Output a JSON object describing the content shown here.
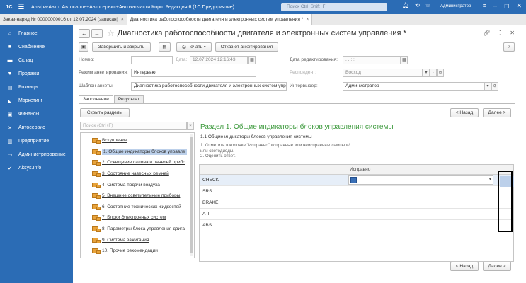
{
  "titlebar": {
    "logo": "1С",
    "title": "Альфа-Авто: Автосалон+Автосервис+Автозапчасти Корп. Редакция 6  (1С:Предприятие)",
    "search_placeholder": "Поиск Ctrl+Shift+F",
    "user": "Администратор"
  },
  "doc_tabs": [
    {
      "label": "Заказ-наряд № 00000000016 от 12.07.2024 (записан)",
      "close": "×"
    },
    {
      "label": "Диагностика работоспособности двигателя и электронных систем управления *",
      "close": "×"
    }
  ],
  "sidebar": {
    "items": [
      {
        "icon": "home-icon",
        "glyph": "⌂",
        "label": "Главное"
      },
      {
        "icon": "truck-icon",
        "glyph": "■",
        "label": "Снабжение"
      },
      {
        "icon": "warehouse-icon",
        "glyph": "▬",
        "label": "Склад"
      },
      {
        "icon": "cart-icon",
        "glyph": "▼",
        "label": "Продажи"
      },
      {
        "icon": "store-icon",
        "glyph": "▤",
        "label": "Розница"
      },
      {
        "icon": "megaphone-icon",
        "glyph": "◣",
        "label": "Маркетинг"
      },
      {
        "icon": "finance-icon",
        "glyph": "▣",
        "label": "Финансы"
      },
      {
        "icon": "wrench-icon",
        "glyph": "✕",
        "label": "Автосервис"
      },
      {
        "icon": "enterprise-icon",
        "glyph": "▥",
        "label": "Предприятие"
      },
      {
        "icon": "monitor-icon",
        "glyph": "▭",
        "label": "Администрирование"
      },
      {
        "icon": "aksys-icon",
        "glyph": "✔",
        "label": "Aksys.Info"
      }
    ]
  },
  "form": {
    "title": "Диагностика работоспособности двигателя и электронных систем управления *",
    "toolbar": {
      "save_close": "Завершить и закрыть",
      "print": "Печать",
      "refuse": "Отказ от анкетирования",
      "help": "?"
    },
    "number_label": "Номер:",
    "number_value": "",
    "date_label": "Дата:",
    "date_value": "12.07.2024 12:16:43",
    "edit_date_label": "Дата редактирования:",
    "edit_date_value": " .  .     :  :",
    "mode_label": "Режим анкетирования:",
    "mode_value": "Интервью",
    "respondent_label": "Респондент:",
    "respondent_value": "Восход",
    "template_label": "Шаблон анкеты:",
    "template_value": "Диагностика работоспособности двигателя и электронных систем упр",
    "interviewer_label": "Интервьюер:",
    "interviewer_value": "Администратор"
  },
  "form_tabs": [
    "Заполнение",
    "Результат"
  ],
  "left": {
    "collapse_button": "Скрыть разделы",
    "search_placeholder": "Поиск (Ctrl+F)",
    "clear": "×",
    "sections": [
      "Вступление",
      "1. Общие индикаторы блоков управле",
      "2. Освещение салона и панелей прибо",
      "3. Состояние навесных ремней",
      "4. Система подачи воздуха",
      "5. Внешние осветительные приборы",
      "6. Состояние технических жидкостей",
      "7. Блоки Электронных систем",
      "8. Параметры блока управления двига",
      "9. Система зажигания",
      "10. Прочие рекомендации"
    ]
  },
  "nav": {
    "back": "< Назад",
    "next": "Далее >"
  },
  "section": {
    "title": "Раздел 1. Общие индикаторы блоков управления системы",
    "subtitle": "1.1 Общие индикаторы блоков управления системы",
    "note1": "1. Отметить в колонке \"Исправно\" исправные или неисправные лампы и/или светодиоды.",
    "note2": "2. Оценить ответ.",
    "column": "Исправно",
    "rows": [
      "CHECK",
      "SRS",
      "BRAKE",
      "A-T",
      "ABS"
    ]
  }
}
